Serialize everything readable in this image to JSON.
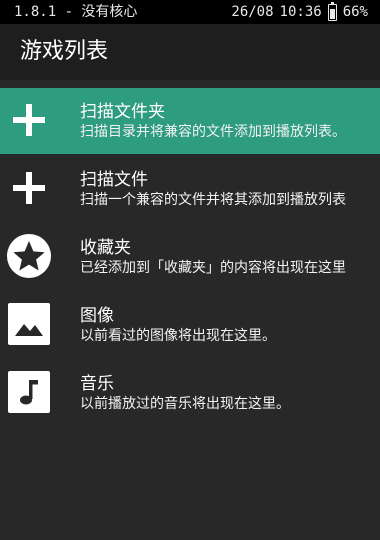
{
  "status_bar": {
    "left_text": "1.8.1 - 没有核心",
    "date": "26/08",
    "time": "10:36",
    "battery": "66%"
  },
  "header": {
    "title": "游戏列表"
  },
  "list": {
    "items": [
      {
        "icon": "plus-icon",
        "title": "扫描文件夹",
        "subtitle": "扫描目录并将兼容的文件添加到播放列表。",
        "selected": true
      },
      {
        "icon": "plus-icon",
        "title": "扫描文件",
        "subtitle": "扫描一个兼容的文件并将其添加到播放列表",
        "selected": false
      },
      {
        "icon": "star-icon",
        "title": "收藏夹",
        "subtitle": "已经添加到「收藏夹」的内容将出现在这里",
        "selected": false
      },
      {
        "icon": "image-icon",
        "title": "图像",
        "subtitle": "以前看过的图像将出现在这里。",
        "selected": false
      },
      {
        "icon": "music-note-icon",
        "title": "音乐",
        "subtitle": "以前播放过的音乐将出现在这里。",
        "selected": false
      }
    ]
  },
  "colors": {
    "background": "#282828",
    "header": "#1e1e1e",
    "status_bar": "#000000",
    "accent_selected": "#2e9c7f",
    "text": "#ffffff"
  }
}
